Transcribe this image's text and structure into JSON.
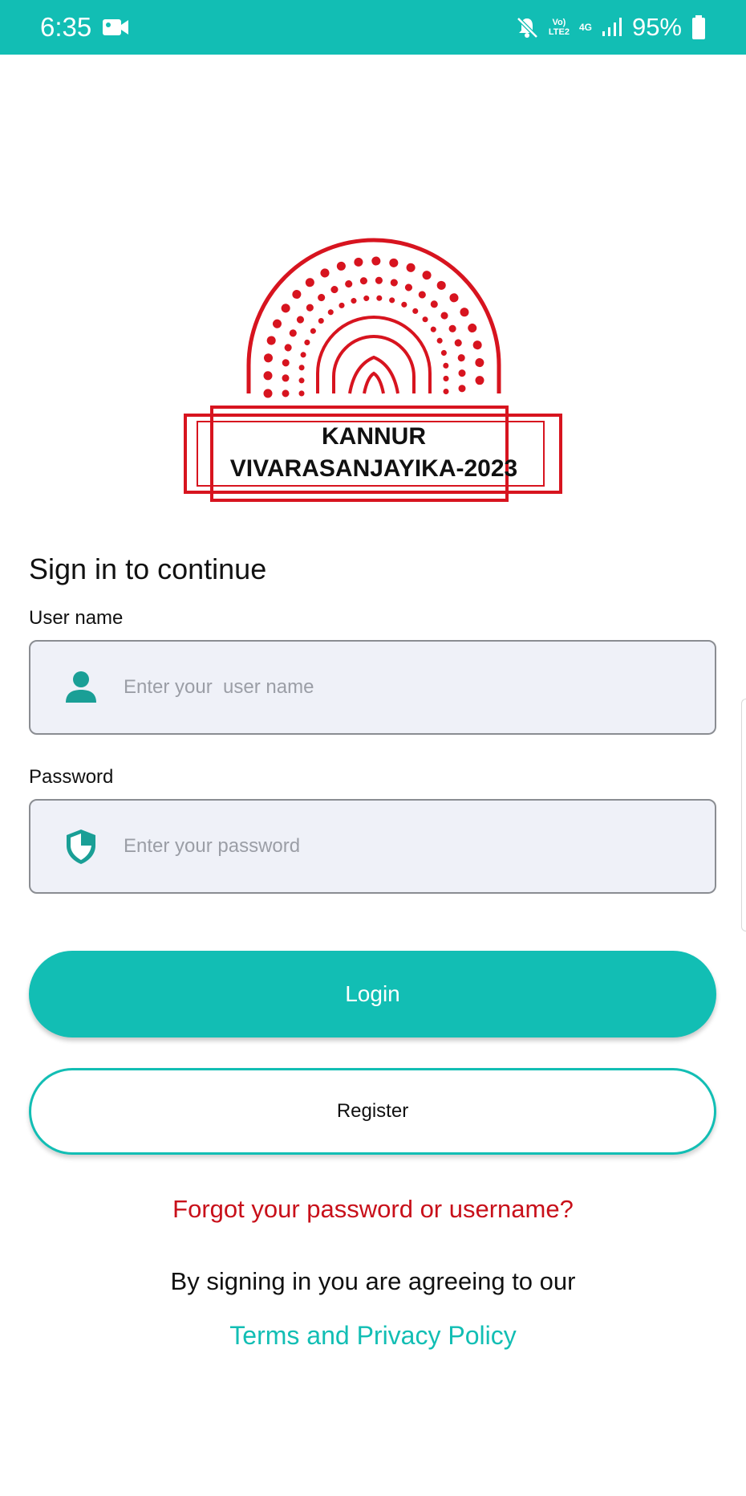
{
  "status_bar": {
    "time": "6:35",
    "network_top": "Vo)",
    "network_bottom": "LTE2",
    "network_type": "4G",
    "battery": "95%",
    "icons": [
      "video-camera-icon",
      "mute-icon",
      "signal-icon",
      "battery-icon"
    ]
  },
  "logo": {
    "line1": "KANNUR",
    "line2": "VIVARASANJAYIKA-2023",
    "color": "#d7141f"
  },
  "form": {
    "title": "Sign in to continue",
    "username_label": "User name",
    "username_placeholder": "Enter your  user name",
    "username_value": "",
    "username_icon": "person-icon",
    "password_label": "Password",
    "password_placeholder": "Enter your password",
    "password_value": "",
    "password_icon": "shield-icon"
  },
  "buttons": {
    "login": "Login",
    "register": "Register"
  },
  "links": {
    "forgot": "Forgot your password or username?",
    "agreement": "By signing in you are agreeing to our",
    "terms": "Terms and Privacy Policy"
  },
  "colors": {
    "accent": "#12beb4",
    "link_red": "#c8101a",
    "input_bg": "#eff1f8"
  }
}
